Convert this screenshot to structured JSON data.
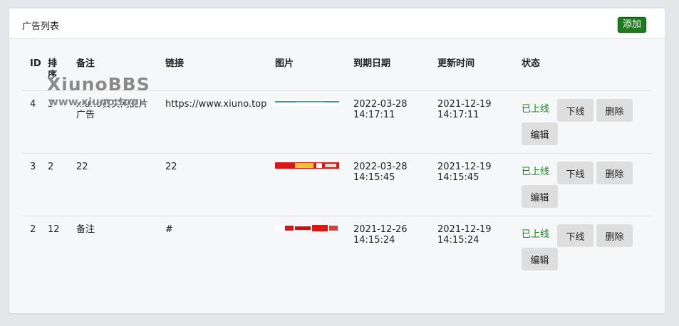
{
  "header": {
    "title": "广告列表",
    "add_label": "添加"
  },
  "table": {
    "headers": [
      "ID",
      "排序",
      "备注",
      "链接",
      "图片",
      "到期日期",
      "更新时间",
      "状态"
    ],
    "rows": [
      {
        "id": "4",
        "rank": "3",
        "note": "xiuno货实网图片广告",
        "link": "https://www.xiuno.top",
        "expires": [
          "2022-03-28",
          "14:17:11"
        ],
        "updated": [
          "2021-12-19",
          "14:17:11"
        ],
        "status": "已上线",
        "thumb": "banner-thumbnail-teal"
      },
      {
        "id": "3",
        "rank": "2",
        "note": "22",
        "link": "22",
        "expires": [
          "2022-03-28",
          "14:15:45"
        ],
        "updated": [
          "2021-12-19",
          "14:15:45"
        ],
        "status": "已上线",
        "thumb": "banner-thumbnail-red-gold"
      },
      {
        "id": "2",
        "rank": "12",
        "note": "备注",
        "link": "#",
        "expires": [
          "2021-12-26",
          "14:15:24"
        ],
        "updated": [
          "2021-12-19",
          "14:15:24"
        ],
        "status": "已上线",
        "thumb": "banner-thumbnail-red-white"
      }
    ],
    "actions": {
      "offline": "下线",
      "delete": "删除",
      "edit": "编辑"
    }
  },
  "watermark": {
    "line1": "XiunoBBS",
    "line2": "www.xiuno.top"
  },
  "colors": {
    "add_button": "#1f7a1f",
    "status_online": "#1a7f1a",
    "action_button_bg": "#dedede"
  }
}
